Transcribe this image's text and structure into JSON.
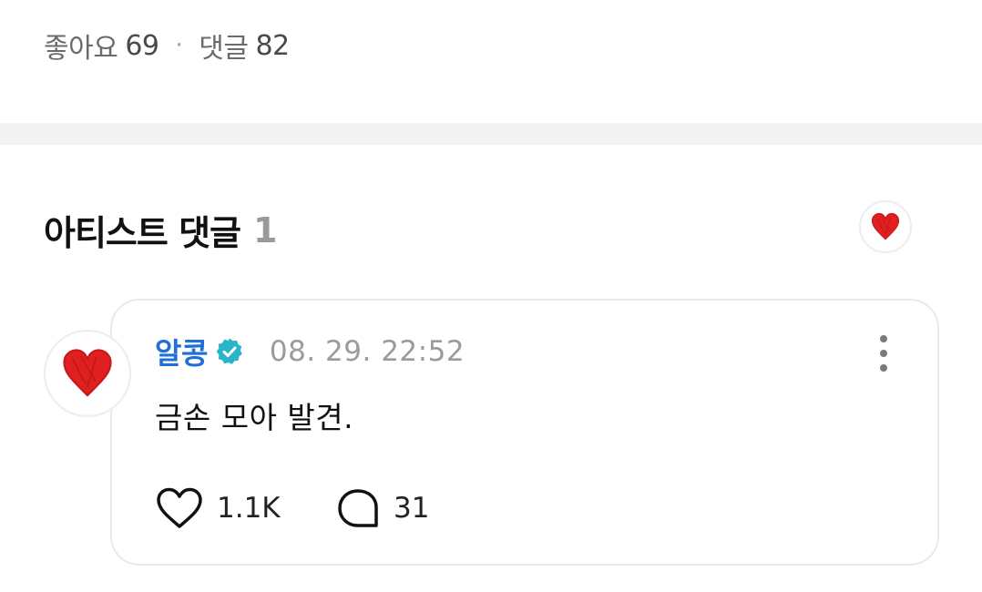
{
  "stats": {
    "likes_label": "좋아요",
    "likes_count": "69",
    "separator": "·",
    "comments_label": "댓글",
    "comments_count": "82"
  },
  "artist_section": {
    "title": "아티스트 댓글",
    "count": "1"
  },
  "comment": {
    "author": "알콩",
    "date": "08. 29. 22:52",
    "text": "금손 모아 발견.",
    "like_count": "1.1K",
    "reply_count": "31"
  },
  "icons": {
    "avatar": "red-heart-icon",
    "verified": "verified-badge-icon",
    "like": "heart-outline-icon",
    "reply": "speech-bubble-icon",
    "more": "more-vertical-icon"
  },
  "colors": {
    "author": "#1f6fd6",
    "verified_badge": "#2ab4c8",
    "heart_red": "#e02020",
    "divider": "#f3f3f3",
    "card_border": "#e9e9e9"
  }
}
